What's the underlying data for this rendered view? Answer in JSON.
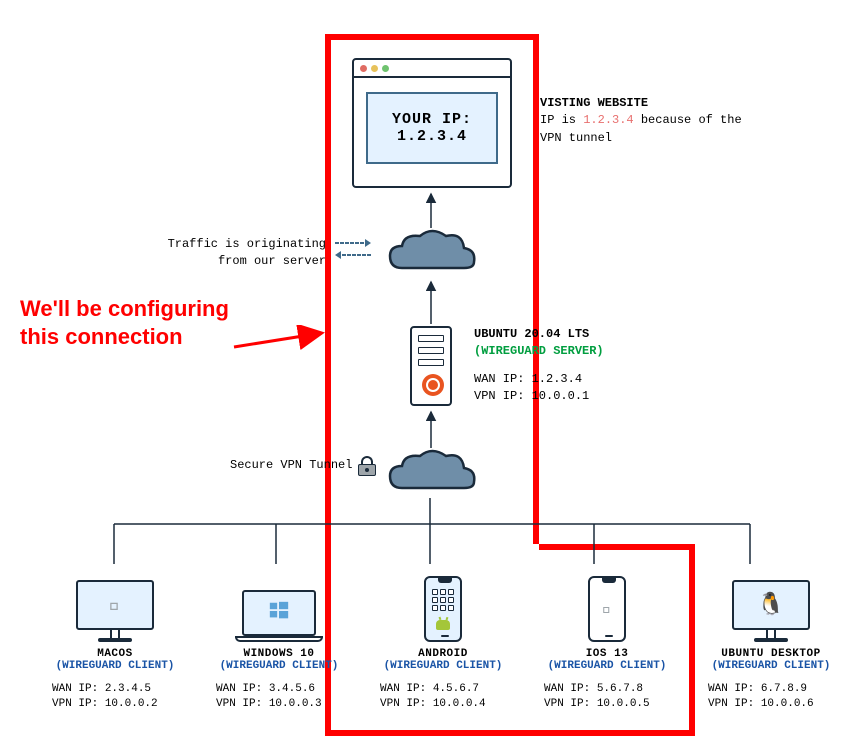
{
  "browser": {
    "line1": "YOUR IP:",
    "line2": "1.2.3.4"
  },
  "visiting": {
    "title": "VISTING WEBSITE",
    "text_pre": "IP is ",
    "ip": "1.2.3.4",
    "text_post": " because of the VPN tunnel"
  },
  "traffic_label_l1": "Traffic is originating",
  "traffic_label_l2": "from our server",
  "callout_l1": "We'll be configuring",
  "callout_l2": "this connection",
  "server": {
    "title": "UBUNTU 20.04 LTS",
    "role": "(WIREGUARD SERVER)",
    "wan_label": "WAN IP: ",
    "wan_ip": "1.2.3.4",
    "vpn_label": "VPN IP: ",
    "vpn_ip": "10.0.0.1"
  },
  "vpn_tunnel_label": "Secure VPN Tunnel",
  "client_role": "(WIREGUARD CLIENT)",
  "wan_label": "WAN IP: ",
  "vpn_label": "VPN IP: ",
  "devices": [
    {
      "name": "MACOS",
      "wan": "2.3.4.5",
      "vpn": "10.0.0.2"
    },
    {
      "name": "WINDOWS 10",
      "wan": "3.4.5.6",
      "vpn": "10.0.0.3"
    },
    {
      "name": "ANDROID",
      "wan": "4.5.6.7",
      "vpn": "10.0.0.4"
    },
    {
      "name": "IOS 13",
      "wan": "5.6.7.8",
      "vpn": "10.0.0.5"
    },
    {
      "name": "UBUNTU DESKTOP",
      "wan": "6.7.8.9",
      "vpn": "10.0.0.6"
    }
  ]
}
